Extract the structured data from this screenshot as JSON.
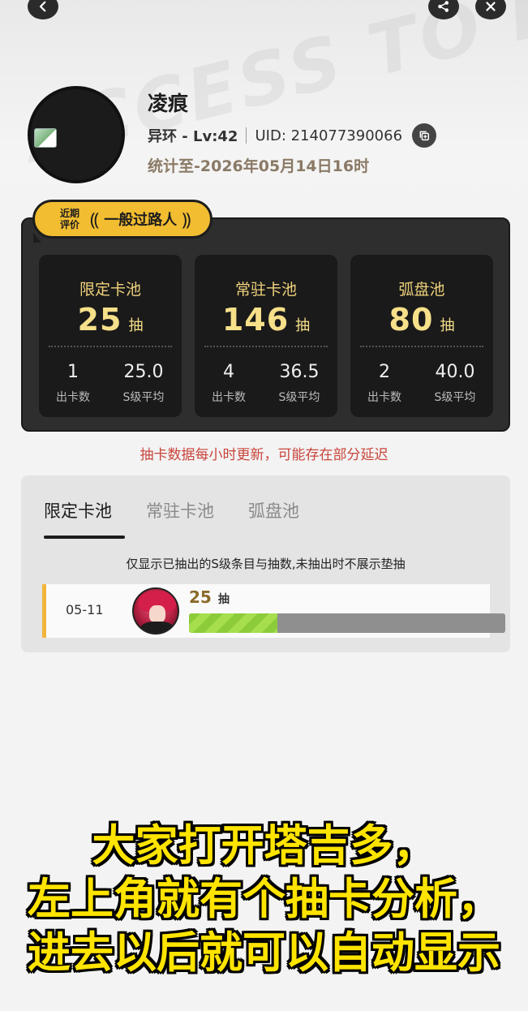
{
  "profile": {
    "name": "凌痕",
    "game_level": "异环 - Lv:42",
    "uid": "UID: 214077390066",
    "stat_date": "统计至-2026年05月14日16时"
  },
  "rating": {
    "label": "近期评价",
    "label_line1": "近期",
    "label_line2": "评价",
    "value": "一般过路人"
  },
  "pools": [
    {
      "name": "限定卡池",
      "count": "25",
      "unit": "抽",
      "cards": "1",
      "cards_label": "出卡数",
      "avg": "25.0",
      "avg_label": "S级平均"
    },
    {
      "name": "常驻卡池",
      "count": "146",
      "unit": "抽",
      "cards": "4",
      "cards_label": "出卡数",
      "avg": "36.5",
      "avg_label": "S级平均"
    },
    {
      "name": "弧盘池",
      "count": "80",
      "unit": "抽",
      "cards": "2",
      "cards_label": "出卡数",
      "avg": "40.0",
      "avg_label": "S级平均"
    }
  ],
  "notice": "抽卡数据每小时更新，可能存在部分延迟",
  "history": {
    "tabs": [
      "限定卡池",
      "常驻卡池",
      "弧盘池"
    ],
    "active_tab": 0,
    "filter_note": "仅显示已抽出的S级条目与抽数,未抽出时不展示垫抽",
    "records": [
      {
        "date": "05-11",
        "count": "25",
        "unit": "抽",
        "progress_fraction": 0.28
      }
    ]
  },
  "subtitle": {
    "line1": "大家打开塔吉多，",
    "line2": "左上角就有个抽卡分析，",
    "line3": "进去以后就可以自动显示"
  },
  "colors": {
    "accent": "#f2bd31",
    "panel_dark": "#2e2e2e",
    "pool_text": "#f0d27c",
    "notice": "#c9453c",
    "progress": "#8ccc3a",
    "subtitle": "#ffe400"
  },
  "icons": [
    "back-icon",
    "share-icon",
    "close-icon",
    "copy-icon",
    "laurel-icon",
    "broken-image-icon"
  ]
}
